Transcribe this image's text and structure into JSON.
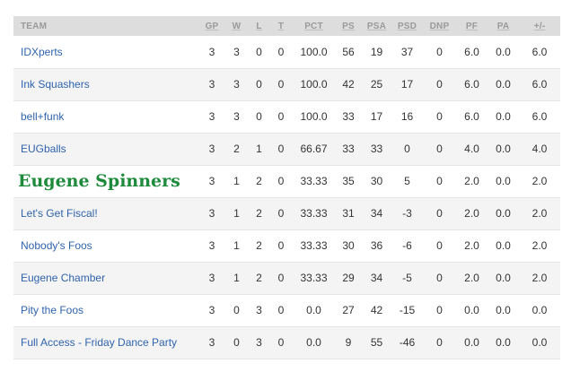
{
  "columns": [
    "TEAM",
    "GP",
    "W",
    "L",
    "T",
    "PCT",
    "PS",
    "PSA",
    "PSD",
    "DNP",
    "PF",
    "PA",
    "+/-"
  ],
  "rows": [
    {
      "team": "IDXperts",
      "stats": [
        "3",
        "3",
        "0",
        "0",
        "100.0",
        "56",
        "19",
        "37",
        "0",
        "6.0",
        "0.0",
        "6.0"
      ]
    },
    {
      "team": "Ink Squashers",
      "stats": [
        "3",
        "3",
        "0",
        "0",
        "100.0",
        "42",
        "25",
        "17",
        "0",
        "6.0",
        "0.0",
        "6.0"
      ]
    },
    {
      "team": "bell+funk",
      "stats": [
        "3",
        "3",
        "0",
        "0",
        "100.0",
        "33",
        "17",
        "16",
        "0",
        "6.0",
        "0.0",
        "6.0"
      ]
    },
    {
      "team": "EUGballs",
      "stats": [
        "3",
        "2",
        "1",
        "0",
        "66.67",
        "33",
        "33",
        "0",
        "0",
        "4.0",
        "0.0",
        "4.0"
      ]
    },
    {
      "team": "Eugene Spinners",
      "stats": [
        "3",
        "1",
        "2",
        "0",
        "33.33",
        "35",
        "30",
        "5",
        "0",
        "2.0",
        "0.0",
        "2.0"
      ]
    },
    {
      "team": "Let's Get Fiscal!",
      "stats": [
        "3",
        "1",
        "2",
        "0",
        "33.33",
        "31",
        "34",
        "-3",
        "0",
        "2.0",
        "0.0",
        "2.0"
      ]
    },
    {
      "team": "Nobody's Foos",
      "stats": [
        "3",
        "1",
        "2",
        "0",
        "33.33",
        "30",
        "36",
        "-6",
        "0",
        "2.0",
        "0.0",
        "2.0"
      ]
    },
    {
      "team": "Eugene Chamber",
      "stats": [
        "3",
        "1",
        "2",
        "0",
        "33.33",
        "29",
        "34",
        "-5",
        "0",
        "2.0",
        "0.0",
        "2.0"
      ]
    },
    {
      "team": "Pity the Foos",
      "stats": [
        "3",
        "0",
        "3",
        "0",
        "0.0",
        "27",
        "42",
        "-15",
        "0",
        "0.0",
        "0.0",
        "0.0"
      ]
    },
    {
      "team": "Full Access - Friday Dance Party",
      "stats": [
        "3",
        "0",
        "3",
        "0",
        "0.0",
        "9",
        "55",
        "-46",
        "0",
        "0.0",
        "0.0",
        "0.0"
      ]
    }
  ],
  "highlight_row_index": 4,
  "colors": {
    "link": "#2f63ad",
    "highlight": "#1e8a3c",
    "header_bg": "#dddddd",
    "header_text": "#9a9a9a",
    "stripe": "#f4f4f4"
  }
}
